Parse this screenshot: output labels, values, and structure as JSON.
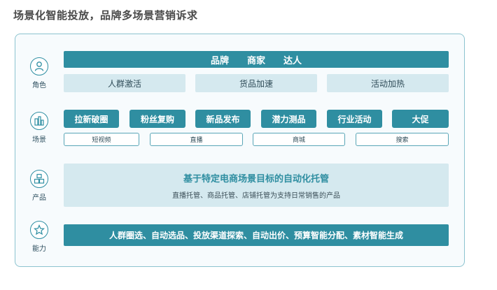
{
  "title": "场景化智能投放，品牌多场景营销诉求",
  "roles": [
    {
      "label": "角色",
      "icon": "person-icon"
    },
    {
      "label": "场景",
      "icon": "buildings-icon"
    },
    {
      "label": "产品",
      "icon": "boxes-icon"
    },
    {
      "label": "能力",
      "icon": "star-icon"
    }
  ],
  "role_row": {
    "header": [
      "品牌",
      "商家",
      "达人"
    ],
    "items": [
      "人群激活",
      "货品加速",
      "活动加热"
    ]
  },
  "scene_row": {
    "primary": [
      "拉新破圈",
      "粉丝复购",
      "新品发布",
      "潜力测品",
      "行业活动",
      "大促"
    ],
    "secondary": [
      "短视频",
      "直播",
      "商城",
      "搜索"
    ]
  },
  "product_row": {
    "title": "基于特定电商场景目标的自动化托管",
    "subtitle": "直播托管、商品托管、店铺托管为支持日常销售的产品"
  },
  "capability_row": {
    "text": "人群圈选、自动选品、投放渠道探索、自动出价、预算智能分配、素材智能生成"
  },
  "colors": {
    "primary": "#2f8ea1",
    "light": "#d5e9ef",
    "border": "#8cc3cf"
  }
}
